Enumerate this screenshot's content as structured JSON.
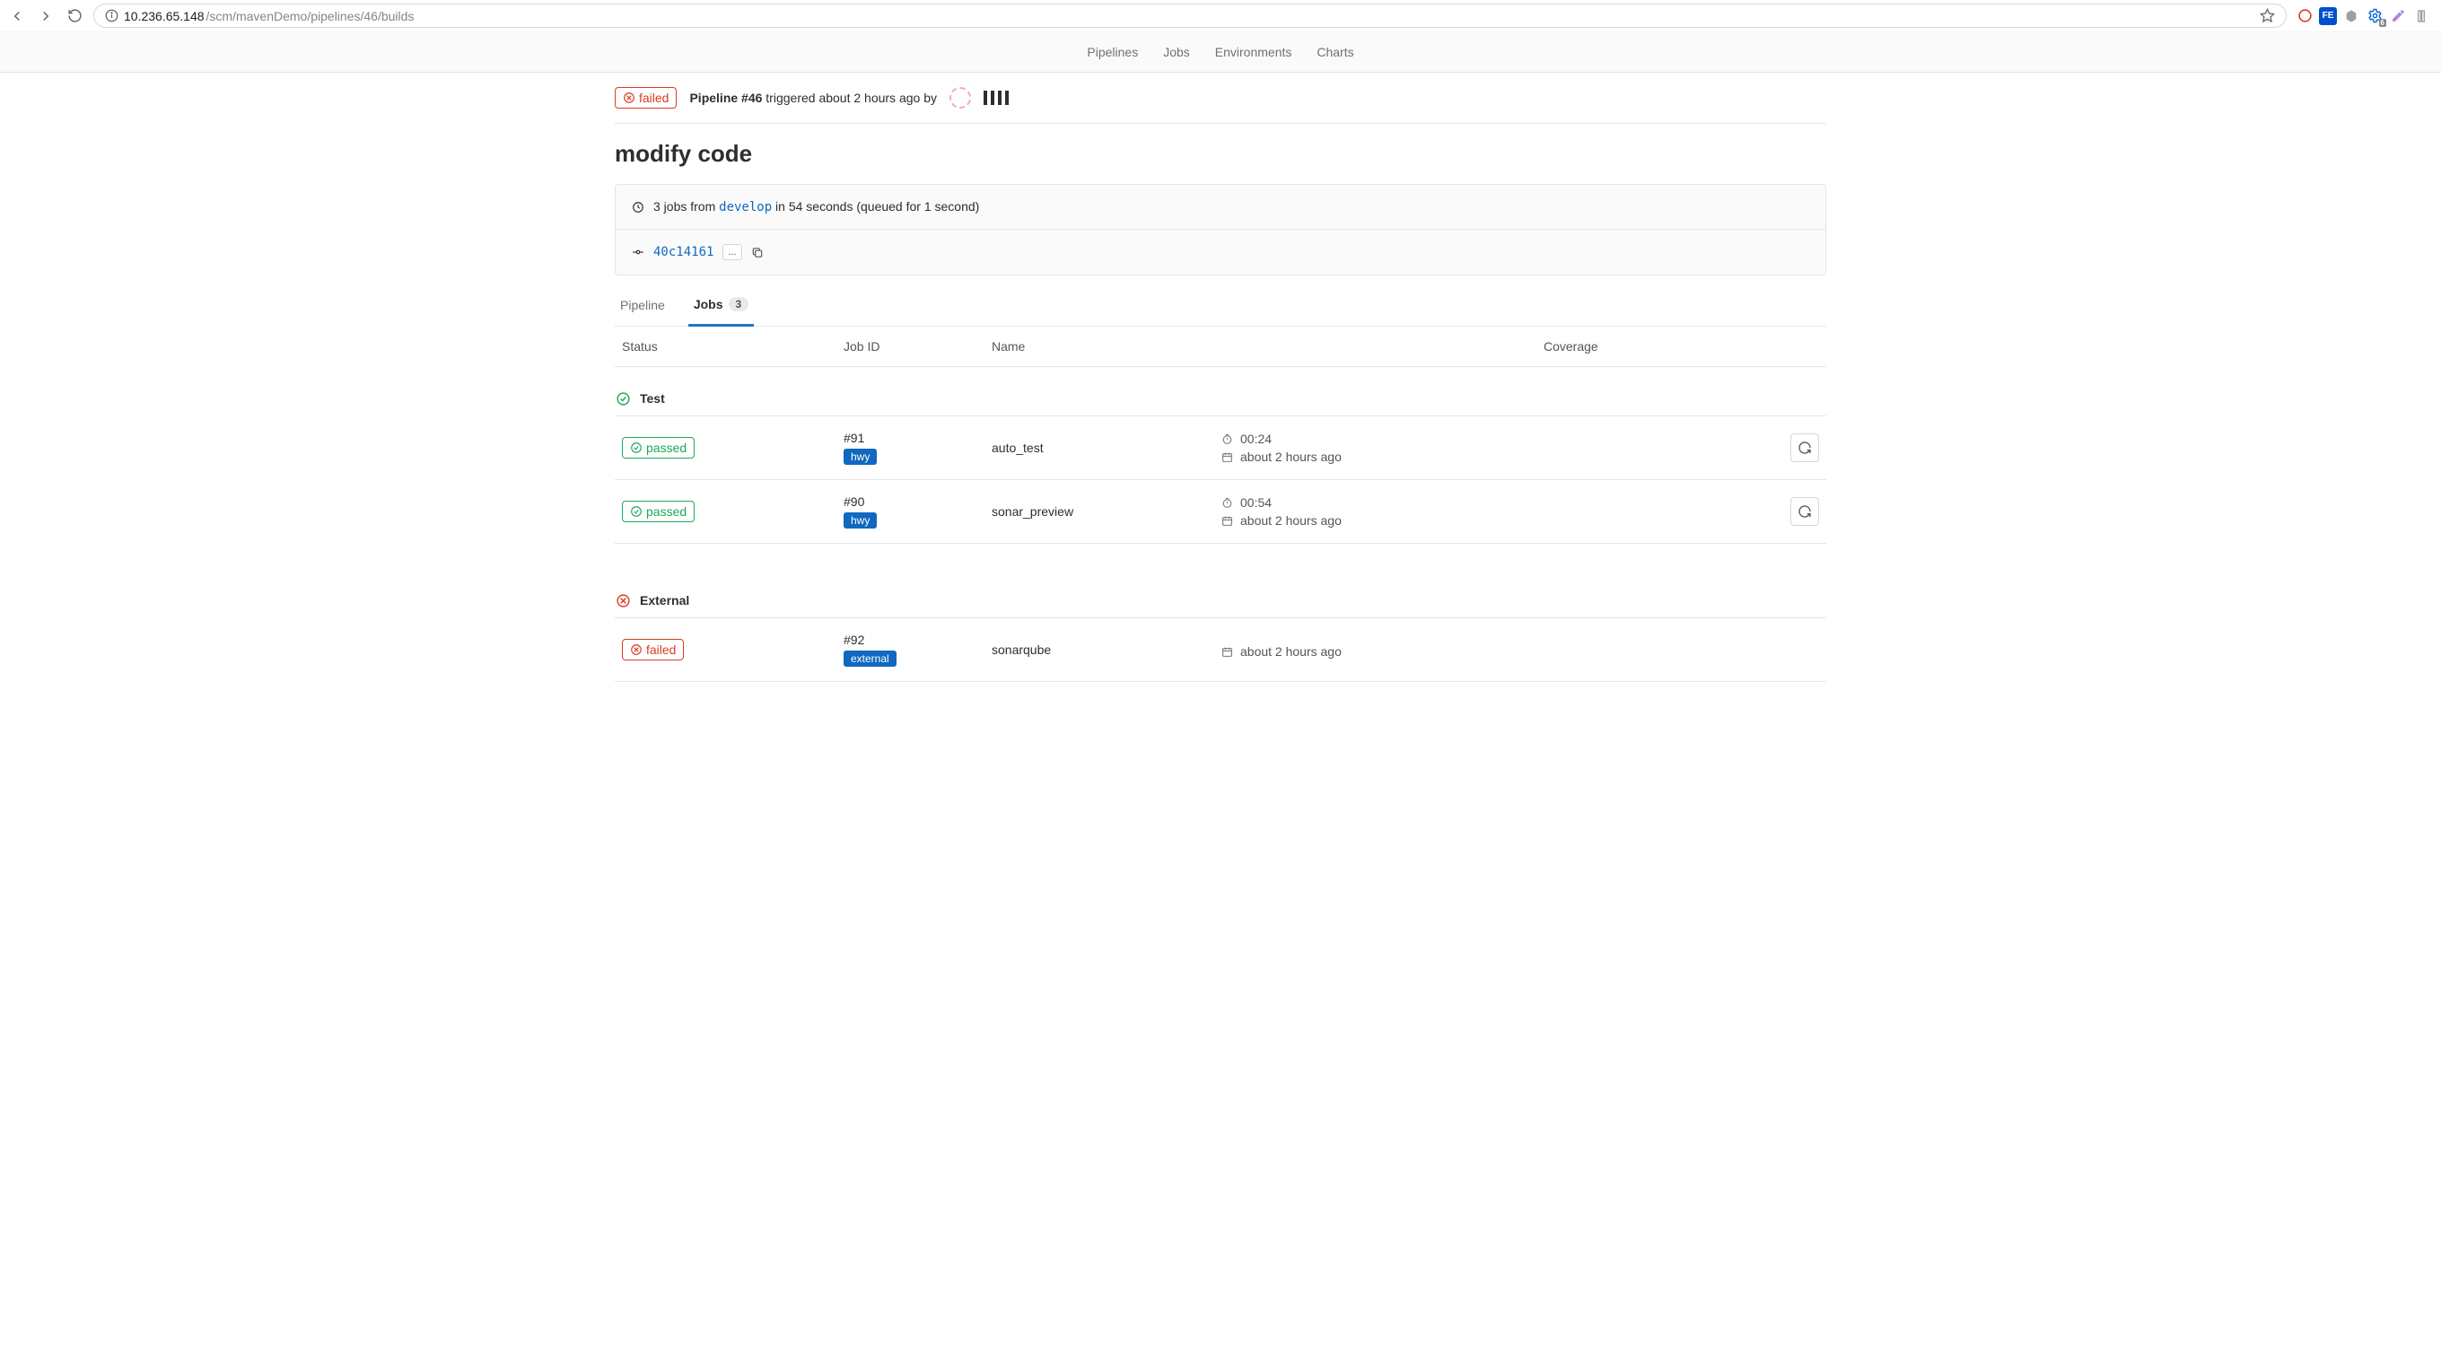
{
  "browser": {
    "url_host": "10.236.65.148",
    "url_path": "/scm/mavenDemo/pipelines/46/builds",
    "ext_gear_badge": "6"
  },
  "nav": {
    "pipelines": "Pipelines",
    "jobs": "Jobs",
    "environments": "Environments",
    "charts": "Charts"
  },
  "pipeline": {
    "status": "failed",
    "title_prefix": "Pipeline #46",
    "trigger_text": " triggered about 2 hours ago by",
    "page_title": "modify code"
  },
  "info": {
    "jobs_count_prefix": "3 jobs from ",
    "branch": "develop",
    "jobs_count_suffix": " in 54 seconds (queued for 1 second)",
    "commit_sha": "40c14161",
    "expand_dots": "..."
  },
  "tabs": {
    "pipeline": "Pipeline",
    "jobs": "Jobs",
    "jobs_count": "3"
  },
  "columns": {
    "status": "Status",
    "job_id": "Job ID",
    "name": "Name",
    "coverage": "Coverage"
  },
  "stages": [
    {
      "name": "Test",
      "status": "passed",
      "jobs": [
        {
          "status": "passed",
          "id": "#91",
          "runner": "hwy",
          "name": "auto_test",
          "duration": "00:24",
          "when": "about 2 hours ago"
        },
        {
          "status": "passed",
          "id": "#90",
          "runner": "hwy",
          "name": "sonar_preview",
          "duration": "00:54",
          "when": "about 2 hours ago"
        }
      ]
    },
    {
      "name": "External",
      "status": "failed",
      "jobs": [
        {
          "status": "failed",
          "id": "#92",
          "runner": "external",
          "name": "sonarqube",
          "duration": "",
          "when": "about 2 hours ago"
        }
      ]
    }
  ]
}
